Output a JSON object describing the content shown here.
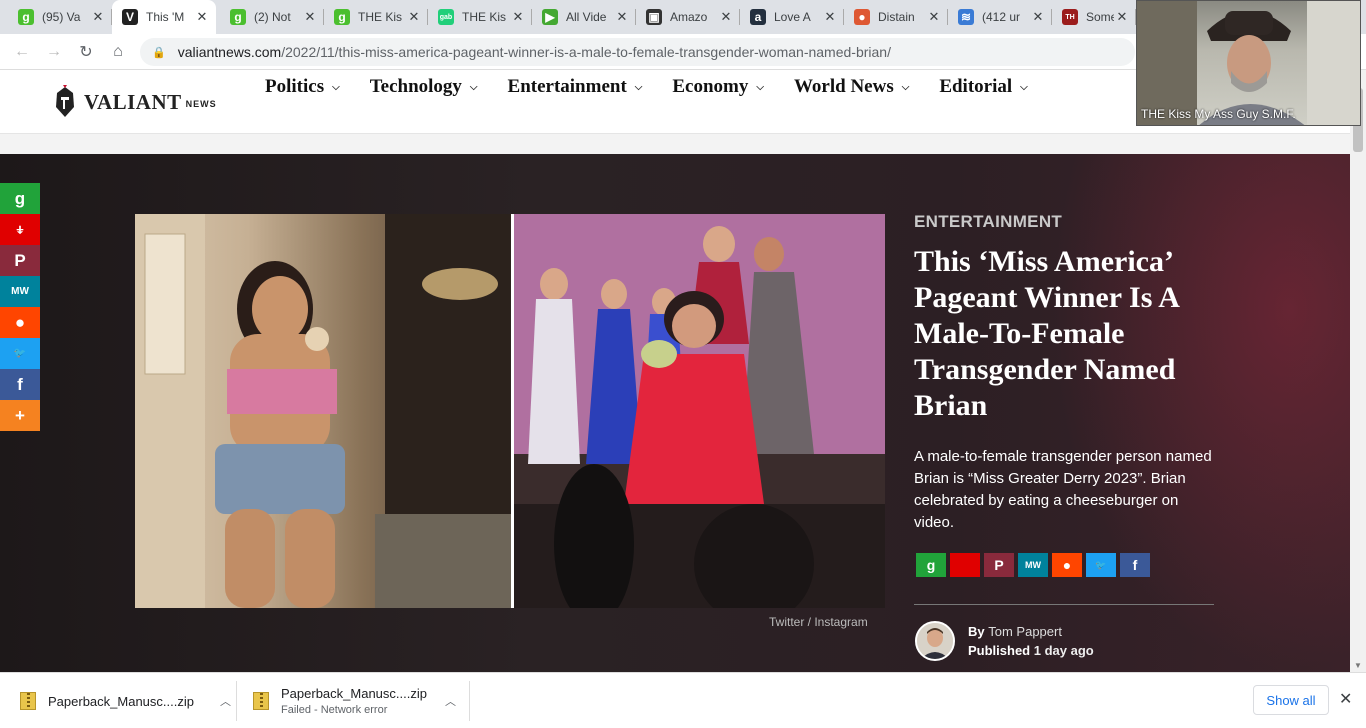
{
  "tabs": [
    {
      "title": "(95) Va",
      "favicon": "g",
      "favicon_color": "#4bbf2f",
      "active": false
    },
    {
      "title": "This 'M",
      "favicon": "V",
      "favicon_color": "#222222",
      "active": true
    },
    {
      "title": "(2) Not",
      "favicon": "g",
      "favicon_color": "#4bbf2f",
      "active": false
    },
    {
      "title": "THE Kis",
      "favicon": "g",
      "favicon_color": "#4bbf2f",
      "active": false
    },
    {
      "title": "THE Kis",
      "favicon": "gab",
      "favicon_color": "#21cf7a",
      "active": false
    },
    {
      "title": "All Vide",
      "favicon": "▶",
      "favicon_color": "#44a832",
      "active": false
    },
    {
      "title": "Amazo",
      "favicon": "▣",
      "favicon_color": "#333333",
      "active": false
    },
    {
      "title": "Love A",
      "favicon": "a",
      "favicon_color": "#232f3e",
      "active": false
    },
    {
      "title": "Distain",
      "favicon": "●",
      "favicon_color": "#de5833",
      "active": false
    },
    {
      "title": "(412 ur",
      "favicon": "≋",
      "favicon_color": "#3a7bd5",
      "active": false
    },
    {
      "title": "Someth",
      "favicon": "TH",
      "favicon_color": "#9b1c1c",
      "active": false
    }
  ],
  "address_bar": {
    "host": "valiantnews.com",
    "path": "/2022/11/this-miss-america-pageant-winner-is-a-male-to-female-transgender-woman-named-brian/"
  },
  "site": {
    "brand": "VALIANT",
    "brand_suffix": "NEWS",
    "nav": [
      "Politics",
      "Technology",
      "Entertainment",
      "Economy",
      "World News",
      "Editorial"
    ]
  },
  "article": {
    "category": "ENTERTAINMENT",
    "headline": "This ‘Miss America’ Pageant Winner Is A Male-To-Female Transgender Named Brian",
    "summary": "A male-to-female transgender person named Brian is “Miss Greater Derry 2023”. Brian celebrated by eating a cheeseburger on video.",
    "photo_credit": "Twitter / Instagram",
    "by_label": "By",
    "author": "Tom Pappert",
    "published_label": "Published",
    "published_when": "1 day ago",
    "share_buttons": [
      {
        "icon": "gab-icon",
        "glyph": "g",
        "color": "#21a33a"
      },
      {
        "icon": "gettr-icon",
        "glyph": "",
        "color": "#e00000"
      },
      {
        "icon": "parler-icon",
        "glyph": "P",
        "color": "#892a3c"
      },
      {
        "icon": "mewe-icon",
        "glyph": "MW",
        "color": "#00829c"
      },
      {
        "icon": "reddit-icon",
        "glyph": "●",
        "color": "#ff4500"
      },
      {
        "icon": "twitter-icon",
        "glyph": "🐦",
        "color": "#1da1f2"
      },
      {
        "icon": "facebook-icon",
        "glyph": "f",
        "color": "#3b5998"
      }
    ]
  },
  "side_rail": [
    {
      "icon": "gab-icon",
      "glyph": "g",
      "color": "#21a33a"
    },
    {
      "icon": "gettr-icon",
      "glyph": "⍖",
      "color": "#e00000"
    },
    {
      "icon": "parler-icon",
      "glyph": "P",
      "color": "#892a3c"
    },
    {
      "icon": "mewe-icon",
      "glyph": "MW",
      "color": "#00829c"
    },
    {
      "icon": "reddit-icon",
      "glyph": "●",
      "color": "#ff4500"
    },
    {
      "icon": "twitter-icon",
      "glyph": "🐦",
      "color": "#1da1f2"
    },
    {
      "icon": "facebook-icon",
      "glyph": "f",
      "color": "#3b5998"
    },
    {
      "icon": "more-icon",
      "glyph": "+",
      "color": "#f58220"
    }
  ],
  "webcam": {
    "label": "THE Kiss My Ass Guy  S.M.F."
  },
  "downloads": {
    "items": [
      {
        "name": "Paperback_Manusc....zip",
        "status": ""
      },
      {
        "name": "Paperback_Manusc....zip",
        "status": "Failed - Network error"
      }
    ],
    "show_all": "Show all"
  }
}
